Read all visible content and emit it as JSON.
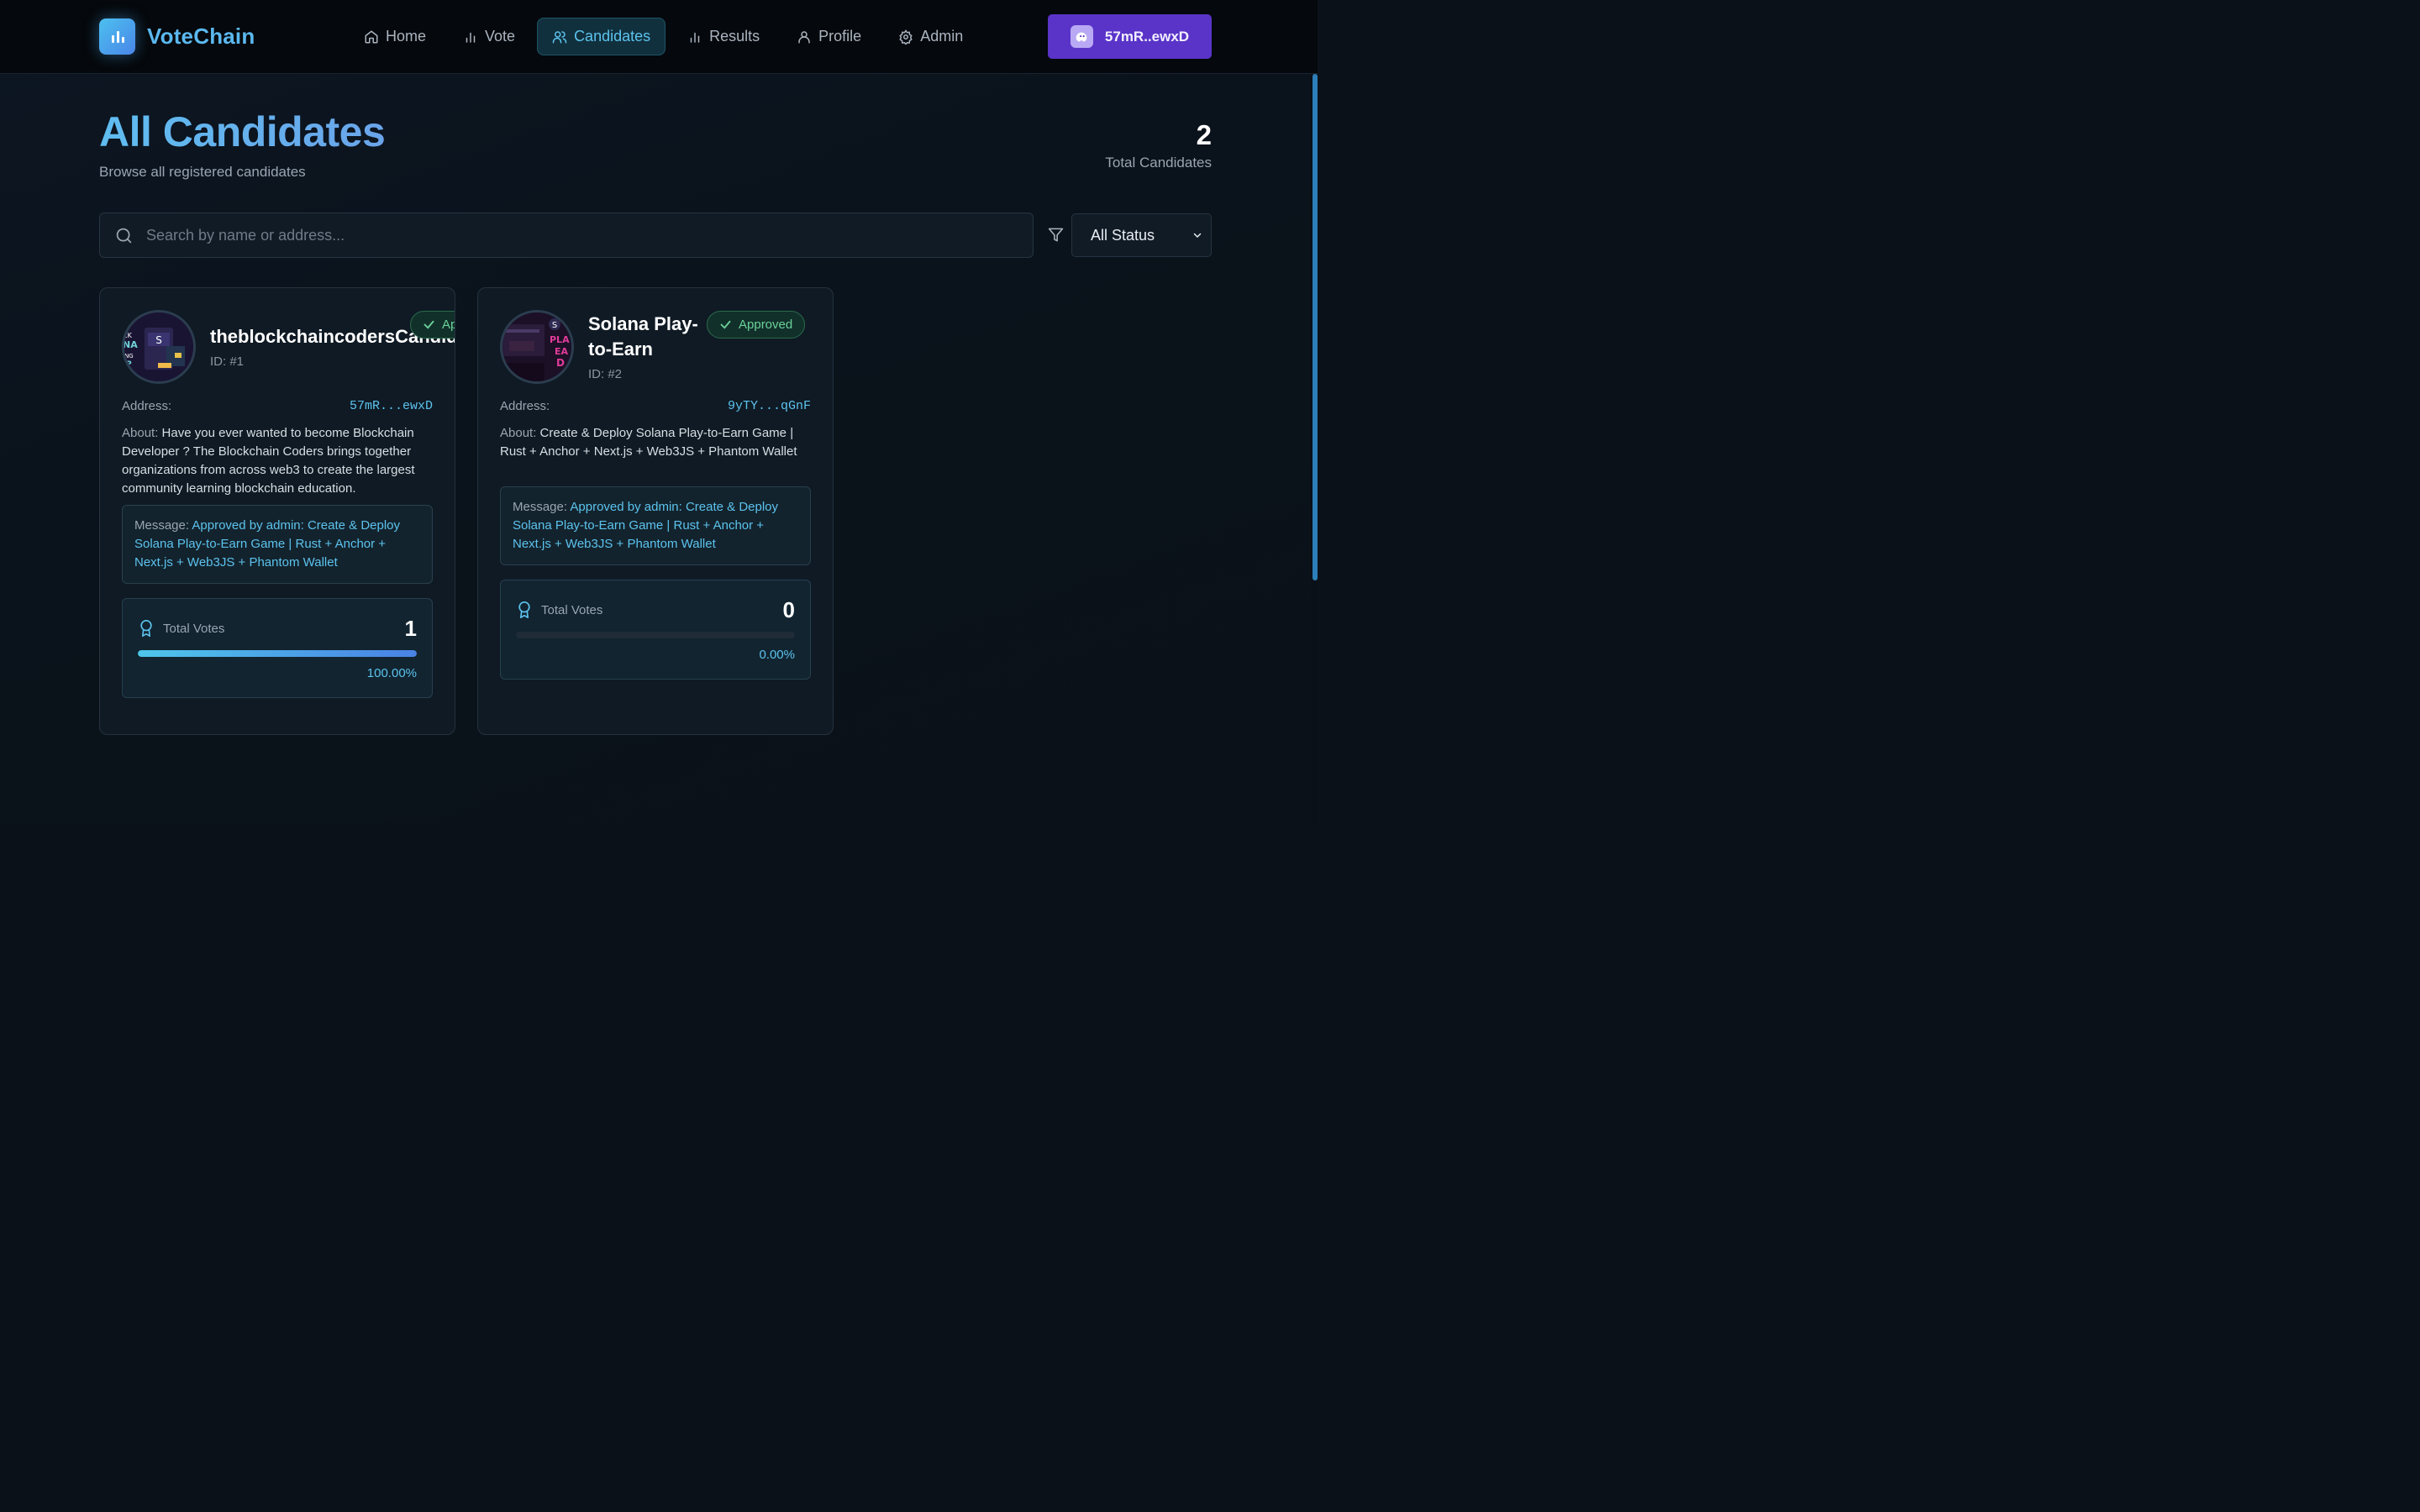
{
  "app": {
    "name": "VoteChain",
    "accent": "#5bb8ef",
    "wallet_accent": "#5a34c8"
  },
  "nav": {
    "items": [
      {
        "label": "Home",
        "icon": "home-icon"
      },
      {
        "label": "Vote",
        "icon": "bar-chart-icon"
      },
      {
        "label": "Candidates",
        "icon": "users-icon",
        "active": true
      },
      {
        "label": "Results",
        "icon": "bar-chart-icon"
      },
      {
        "label": "Profile",
        "icon": "user-icon"
      },
      {
        "label": "Admin",
        "icon": "gear-icon"
      }
    ]
  },
  "wallet": {
    "label": "57mR..ewxD",
    "icon": "ghost-icon"
  },
  "page": {
    "title": "All Candidates",
    "subtitle": "Browse all registered candidates",
    "total_count": "2",
    "total_label": "Total Candidates"
  },
  "search": {
    "placeholder": "Search by name or address..."
  },
  "filter": {
    "selected": "All Status"
  },
  "labels": {
    "address": "Address:",
    "about": "About:",
    "message": "Message:",
    "total_votes": "Total Votes"
  },
  "candidates": [
    {
      "name": "theblockchaincodersCandidate",
      "id": "ID: #1",
      "status": "Approved",
      "status_visible": "Appro",
      "address": "57mR...ewxD",
      "about": "Have you ever wanted to become Blockchain Developer ? The Blockchain Coders brings together organizations from across web3 to create the largest community learning blockchain education.",
      "message": "Approved by admin: Create & Deploy Solana Play-to-Earn Game | Rust + Anchor + Next.js + Web3JS + Phantom Wallet",
      "votes": "1",
      "percent": "100.00%",
      "progress": 1.0
    },
    {
      "name_line1": "Solana Play-",
      "name_line2": "to-Earn",
      "id": "ID: #2",
      "status": "Approved",
      "address": "9yTY...qGnF",
      "about": "Create & Deploy Solana Play-to-Earn Game | Rust + Anchor + Next.js + Web3JS + Phantom Wallet",
      "message": "Approved by admin: Create & Deploy Solana Play-to-Earn Game | Rust + Anchor + Next.js + Web3JS + Phantom Wallet",
      "votes": "0",
      "percent": "0.00%",
      "progress": 0.0
    }
  ]
}
